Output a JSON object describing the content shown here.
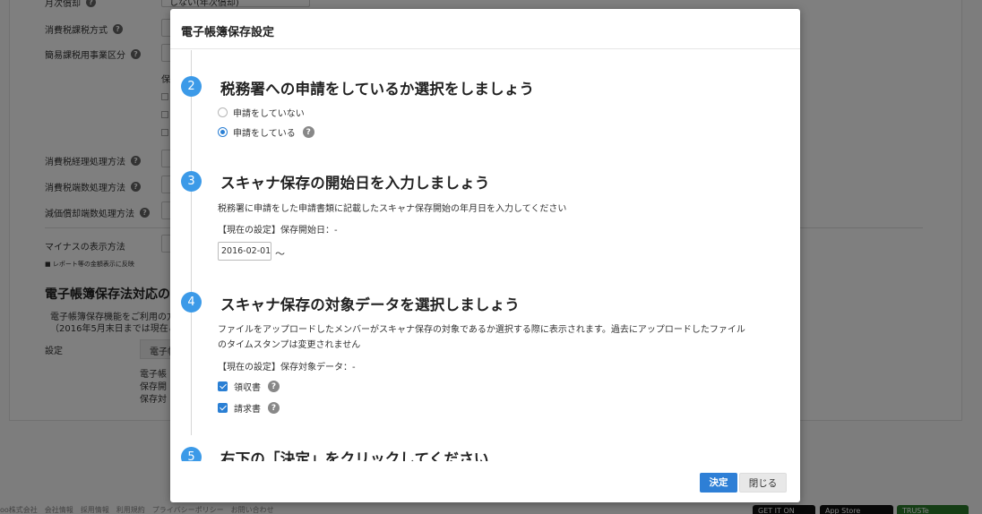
{
  "background": {
    "row_monthly": "月次償却",
    "row_monthly_value": "しない(年次償却)",
    "row_tax_method": "消費税課税方式",
    "row_simple_tax": "簡易課税用事業区分",
    "row_simple_sub": "保",
    "row_tax_processing": "消費税経理処理方法",
    "row_tax_rounding": "消費税端数処理方法",
    "row_depreciation_rounding": "減価償却端数処理方法",
    "row_minus_display": "マイナスの表示方法",
    "note_report": "■ レポート等の金額表示に反映",
    "section_title": "電子帳簿保存法対応の",
    "section_desc_1": "電子帳簿保存機能をご利用の方",
    "section_desc_2": "（2016年5月末日までは現在こ",
    "setting_label": "設定",
    "setting_button": "電子帳",
    "setting_info_1": "電子帳",
    "setting_info_2": "保存開",
    "setting_info_3": "保存対",
    "footer_links": "oo株式会社　会社情報　採用情報　利用規約　プライバシーポリシー　お問い合わせ",
    "badge_google": "GET IT ON",
    "badge_appstore": "App Store",
    "badge_truste": "TRUSTe"
  },
  "modal": {
    "title": "電子帳簿保存設定",
    "steps": [
      {
        "num": "2",
        "title": "税務署への申請をしているか選択をしましょう",
        "options": [
          {
            "label": "申請をしていない",
            "selected": false
          },
          {
            "label": "申請をしている",
            "selected": true
          }
        ]
      },
      {
        "num": "3",
        "title": "スキャナ保存の開始日を入力しましょう",
        "desc": "税務署に申請をした申請書類に記載したスキャナ保存開始の年月日を入力してください",
        "current": "【現在の設定】保存開始日：-",
        "date_value": "2016-02-01",
        "tilde": "～"
      },
      {
        "num": "4",
        "title": "スキャナ保存の対象データを選択しましょう",
        "desc_1": "ファイルをアップロードしたメンバーがスキャナ保存の対象であるか選択する際に表示されます。過去にアップロードしたファイル",
        "desc_2": "のタイムスタンプは変更されません",
        "current": "【現在の設定】保存対象データ：-",
        "checks": [
          {
            "label": "領収書",
            "checked": true
          },
          {
            "label": "請求書",
            "checked": true
          }
        ]
      },
      {
        "num": "5",
        "title": "右下の「決定」をクリックしてください"
      }
    ],
    "ok_label": "決定",
    "close_label": "閉じる",
    "help_glyph": "?"
  },
  "colors": {
    "accent": "#2e7fd6",
    "step_circle": "#3c9ae8",
    "overlay": "#000000"
  }
}
